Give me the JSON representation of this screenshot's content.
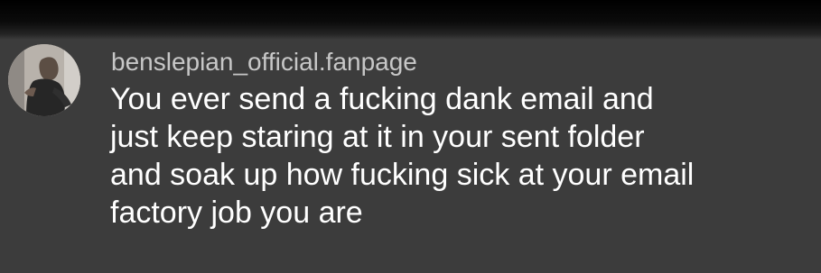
{
  "comment": {
    "username": "benslepian_official.fanpage",
    "text_lines": [
      "You ever send a fucking dank email and",
      "just keep staring at it in your sent folder",
      "and soak up how fucking sick at your email",
      "factory job you are"
    ],
    "avatar_icon": "profile-photo-avatar"
  },
  "colors": {
    "background": "#3c3c3c",
    "top_band": "#000000",
    "username_text": "#c7c7c7",
    "comment_text": "#ffffff"
  }
}
